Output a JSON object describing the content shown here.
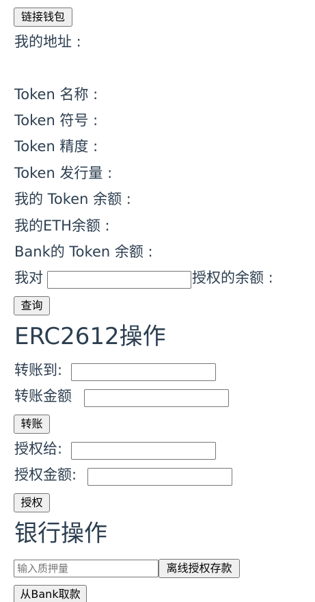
{
  "wallet": {
    "connect_label": "链接钱包",
    "address_label": "我的地址 :",
    "address_value": ""
  },
  "token_info": {
    "name_label": "Token 名称 :",
    "symbol_label": "Token 符号 :",
    "decimals_label": "Token 精度 :",
    "supply_label": "Token 发行量 :",
    "my_balance_label": "我的 Token 余额 :",
    "my_eth_label": "我的ETH余额 :",
    "bank_balance_label": "Bank的 Token 余额 :"
  },
  "allowance": {
    "prefix": "我对",
    "suffix": "授权的余额 :",
    "input_value": "",
    "query_label": "查询"
  },
  "erc2612": {
    "heading": "ERC2612操作",
    "transfer_to_label": "转账到:",
    "transfer_to_value": "",
    "transfer_amount_label": "转账金额",
    "transfer_amount_value": "",
    "transfer_button": "转账",
    "approve_to_label": "授权给:",
    "approve_to_value": "",
    "approve_amount_label": "授权金额:",
    "approve_amount_value": "",
    "approve_button": "授权"
  },
  "bank": {
    "heading": "银行操作",
    "deposit_placeholder": "输入质押量",
    "permit_deposit_button": "离线授权存款",
    "withdraw_button": "从Bank取款"
  }
}
